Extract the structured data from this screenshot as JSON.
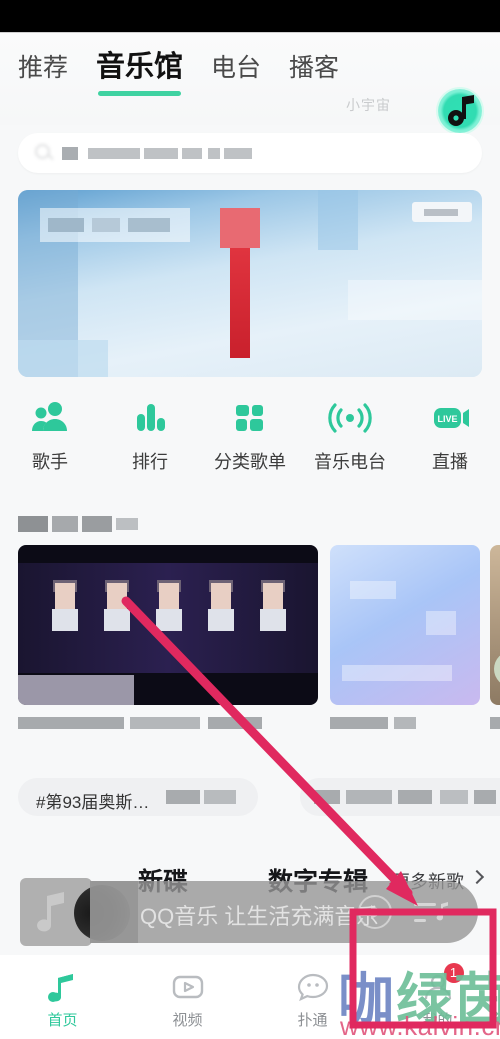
{
  "app": {
    "name": "QQ音乐",
    "platform": "Android"
  },
  "header": {
    "tabs": [
      {
        "label": "推荐",
        "active": false
      },
      {
        "label": "音乐馆",
        "active": true
      },
      {
        "label": "电台",
        "active": false
      },
      {
        "label": "播客",
        "active": false
      }
    ],
    "sub_tag": "小宇宙",
    "avatar_icon": "qq-music-logo-icon"
  },
  "search": {
    "icon": "search-icon",
    "placeholder_redacted": true,
    "value": ""
  },
  "banner": {
    "type": "promo-carousel",
    "redacted": true,
    "dominant_color": "#9cc7e6",
    "accent_color": "#e0343f"
  },
  "quick_entries": [
    {
      "label": "歌手",
      "icon": "singer-icon"
    },
    {
      "label": "排行",
      "icon": "chart-bars-icon"
    },
    {
      "label": "分类歌单",
      "icon": "grid-squares-icon"
    },
    {
      "label": "音乐电台",
      "icon": "radio-waves-icon"
    },
    {
      "label": "直播",
      "icon": "live-camera-icon"
    }
  ],
  "section": {
    "title_redacted": true,
    "cards": [
      {
        "title_redacted": true,
        "redacted": true
      },
      {
        "title_redacted": true,
        "redacted": true
      },
      {
        "title_redacted": true,
        "redacted": true
      }
    ]
  },
  "pills": [
    {
      "label": "#第93届奥斯…",
      "redacted_tail": true
    },
    {
      "label": "",
      "redacted": true
    }
  ],
  "new_album_row": {
    "segments": [
      "新碟",
      "数字专辑"
    ],
    "more_label": "更多新歌",
    "chevron_icon": "chevron-right-icon"
  },
  "mini_player": {
    "title": "QQ音乐 让生活充满音乐",
    "album_art_icon": "music-note-icon",
    "vinyl_icon": "vinyl-disc-icon",
    "play_icon": "play-icon",
    "playlist_icon": "playlist-icon",
    "is_playing": false
  },
  "bottom_nav": [
    {
      "label": "首页",
      "icon": "music-note-icon",
      "active": true,
      "badge": ""
    },
    {
      "label": "视频",
      "icon": "video-play-icon",
      "active": false,
      "badge": ""
    },
    {
      "label": "扑通",
      "icon": "community-face-icon",
      "active": false,
      "badge": ""
    },
    {
      "label": "我的",
      "icon": "profile-icon",
      "active": false,
      "badge": "1"
    }
  ],
  "annotation": {
    "arrow_color": "#e0295f",
    "box_color": "#e0295f",
    "description": "箭头指向底部播放器右侧控制区"
  },
  "watermark": {
    "text_a": "咖",
    "text_b": "绿茵",
    "url": "www.kalvin.cn"
  },
  "colors": {
    "brand_green": "#2ec89b",
    "accent_pink": "#e0295f",
    "badge_red": "#e8384f",
    "page_bg": "#f7f8f9"
  }
}
